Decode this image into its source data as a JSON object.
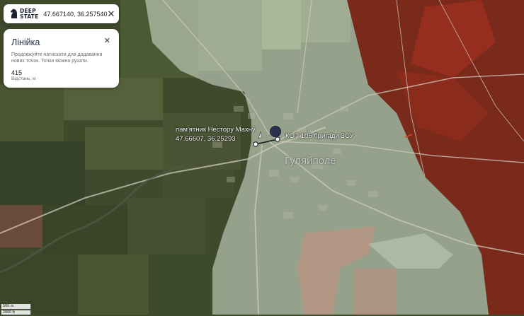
{
  "app": {
    "logo_line1": "DEEP",
    "logo_line2": "STATE",
    "coordinates": "47.667140, 36.257540",
    "close_symbol": "✕"
  },
  "ruler": {
    "title": "Лінійка",
    "hint": "Продовжуйте натискати для додавання нових точок. Точки можна рухати.",
    "distance_value": "415",
    "distance_label": "Відстань, м",
    "close_symbol": "✕"
  },
  "map": {
    "city_name": "Гуляйполе",
    "marker_label": "КСП 106 бригади ЗСУ",
    "monument_label": "пам'ятник Нестору Махну",
    "monument_coords": "47.66607, 36.25293",
    "scale_metric": "500 m",
    "scale_imperial": "2000 ft",
    "colors": {
      "controlled_zone": "#c9d6c4",
      "occupied_zone": "#8c2a1b",
      "brand": "#1e2235",
      "marker": "#2a3050"
    }
  }
}
